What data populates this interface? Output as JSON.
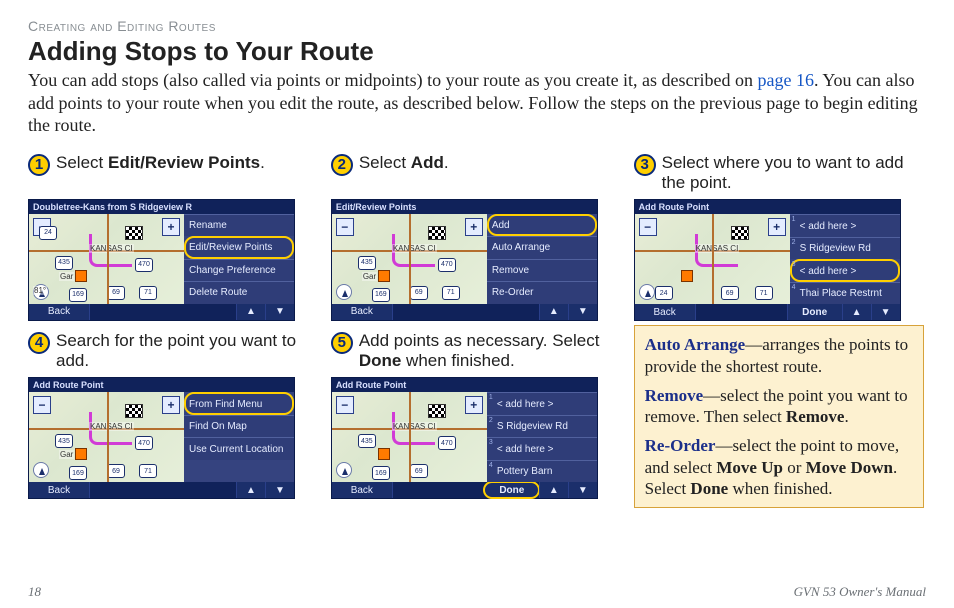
{
  "header": {
    "section": "Creating and Editing Routes",
    "title": "Adding Stops to Your Route",
    "intro_a": "You can add stops (also called via points or midpoints) to your route as you create it, as described on ",
    "intro_link": "page 16",
    "intro_b": ". You can also add points to your route when you edit the route, as described below. Follow the steps on the previous page to begin editing the route."
  },
  "steps": {
    "s1": {
      "num": "1",
      "pre": "Select ",
      "bold": "Edit/Review Points",
      "post": "."
    },
    "s2": {
      "num": "2",
      "pre": "Select ",
      "bold": "Add",
      "post": "."
    },
    "s3": {
      "num": "3",
      "text": "Select where you to want to add the point."
    },
    "s4": {
      "num": "4",
      "text": "Search for the point you want to add."
    },
    "s5": {
      "num": "5",
      "pre": "Add points as necessary. Select ",
      "bold": "Done",
      "post": " when finished."
    }
  },
  "dev1": {
    "title": "Doubletree-Kans from S Ridgeview R",
    "items": [
      "Rename",
      "Edit/Review Points",
      "Change Preference",
      "Delete Route"
    ],
    "hl_index": 1,
    "back": "Back"
  },
  "dev2": {
    "title": "Edit/Review Points",
    "items": [
      "Add",
      "Auto Arrange",
      "Remove",
      "Re-Order"
    ],
    "hl_index": 0,
    "back": "Back"
  },
  "dev3": {
    "title": "Add Route Point",
    "items": [
      "< add here >",
      "S Ridgeview Rd",
      "< add here >",
      "Thai Place Restrnt"
    ],
    "hl_index": 2,
    "back": "Back",
    "done": "Done"
  },
  "dev4": {
    "title": "Add Route Point",
    "items": [
      "From Find Menu",
      "Find On Map",
      "Use Current Location"
    ],
    "hl_index": 0,
    "back": "Back"
  },
  "dev5": {
    "title": "Add Route Point",
    "items": [
      "< add here >",
      "S Ridgeview Rd",
      "< add here >",
      "Pottery Barn"
    ],
    "hl_index": -1,
    "back": "Back",
    "done": "Done",
    "done_hl": true
  },
  "map": {
    "city1": "KANSAS CI",
    "city2": "Gar",
    "hwy1": "435",
    "hwy2": "470",
    "hwy3": "69",
    "hwy4": "71",
    "hwy5": "169",
    "hwy6": "24",
    "temp": "81°"
  },
  "tips": {
    "t1a": "Auto Arrange",
    "t1b": "—arranges the points to provide the shortest route.",
    "t2a": "Remove",
    "t2b": "—select the point you want to remove. Then select ",
    "t2c": "Remove",
    "t2d": ".",
    "t3a": "Re-Order",
    "t3b": "—select the point to move, and select ",
    "t3c": "Move Up",
    "t3d": " or ",
    "t3e": "Move Down",
    "t3f": ". Select ",
    "t3g": "Done",
    "t3h": " when finished."
  },
  "footer": {
    "page": "18",
    "manual": "GVN 53 Owner's Manual"
  }
}
